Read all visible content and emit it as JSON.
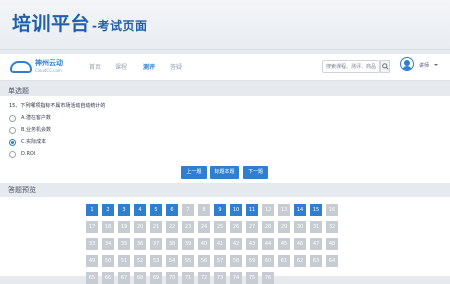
{
  "banner": {
    "title": "培训平台",
    "subtitle": "-考试页面"
  },
  "nav": {
    "logo_text": "神州云动",
    "logo_url": "CloudCC.com",
    "links": [
      "首页",
      "课程",
      "测评",
      "答疑"
    ],
    "active_index": 2,
    "search_placeholder": "搜索课程、测评、商品",
    "user_name": "讲师"
  },
  "question": {
    "section_title": "单选题",
    "text": "15、下列哪项指标不属市场活动自动统计的",
    "options": [
      {
        "label": "A.潜在客户数",
        "selected": false
      },
      {
        "label": "B.业务机会数",
        "selected": false
      },
      {
        "label": "C.实际成本",
        "selected": true
      },
      {
        "label": "D.ROI",
        "selected": false
      }
    ]
  },
  "buttons": {
    "prev": "上一题",
    "mark": "标题本题",
    "next": "下一题"
  },
  "answer_sheet": {
    "title": "答题预览",
    "answered": [
      1,
      2,
      3,
      4,
      5,
      6,
      9,
      10,
      11,
      14,
      15
    ],
    "total": 76,
    "per_row": 16
  },
  "colors": {
    "accent": "#2f7fd1",
    "banner_text": "#205fa9",
    "unanswered": "#c7ccd2"
  }
}
